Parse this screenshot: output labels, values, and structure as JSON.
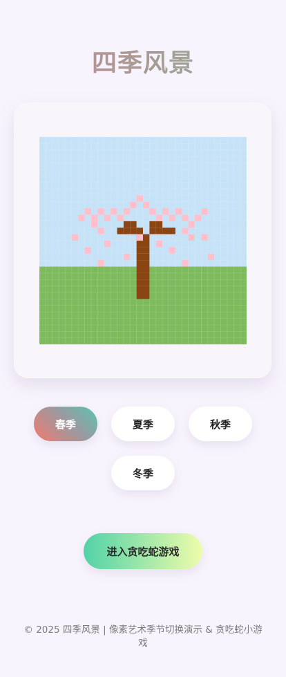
{
  "header": {
    "title": "四季风景"
  },
  "colors": {
    "sky": "#c6e2f7",
    "grass": "#7dbb5d",
    "trunk": "#8b4513",
    "blossom": "#ffc0cb"
  },
  "seasons": [
    {
      "label": "春季",
      "active": true
    },
    {
      "label": "夏季",
      "active": false
    },
    {
      "label": "秋季",
      "active": false
    },
    {
      "label": "冬季",
      "active": false
    }
  ],
  "actions": {
    "game_label": "进入贪吃蛇游戏"
  },
  "footer": {
    "text": "© 2025 四季风景 | 像素艺术季节切换演示 & 贪吃蛇小游戏"
  }
}
